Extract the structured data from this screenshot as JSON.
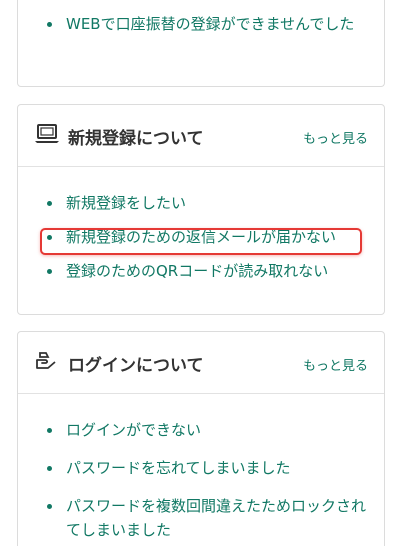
{
  "sections": {
    "partial": {
      "items": [
        {
          "label": "WEBで口座振替の登録ができませんでした"
        }
      ]
    },
    "signup": {
      "title": "新規登録について",
      "icon": "laptop-icon",
      "more_label": "もっと見る",
      "items": [
        {
          "label": "新規登録をしたい"
        },
        {
          "label": "新規登録のための返信メールが届かない"
        },
        {
          "label": "登録のためのQRコードが読み取れない"
        }
      ]
    },
    "login": {
      "title": "ログインについて",
      "icon": "login-hand-icon",
      "more_label": "もっと見る",
      "items": [
        {
          "label": "ログインができない"
        },
        {
          "label": "パスワードを忘れてしまいました"
        },
        {
          "label": "パスワードを複数回間違えたためロックされてしまいました"
        }
      ]
    }
  },
  "colors": {
    "link": "#117864",
    "highlight": "#e53935",
    "border": "#dcdcdc"
  }
}
